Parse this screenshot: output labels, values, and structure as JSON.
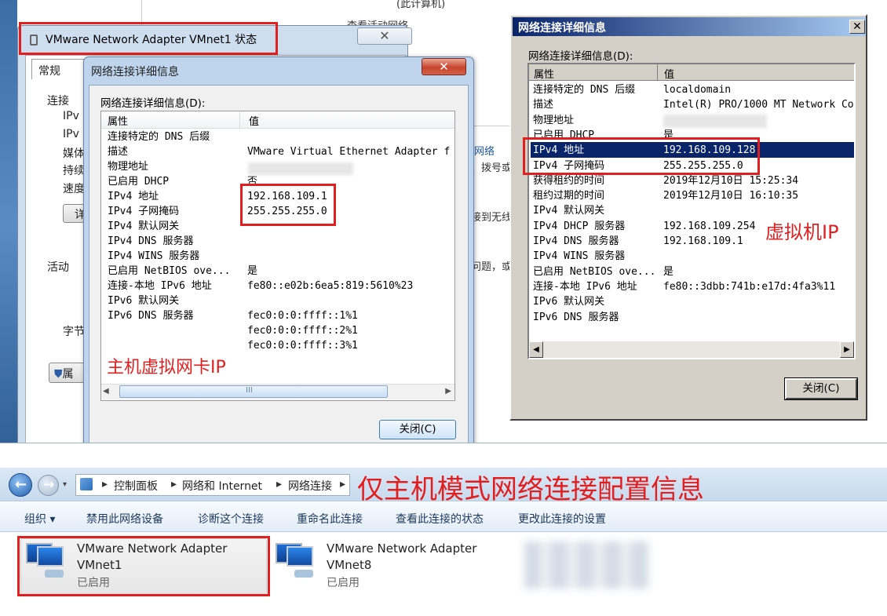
{
  "background": {
    "top_text": "(此计算机)",
    "active_networks": "查看活动网络",
    "link_partial": "网络",
    "dial_partial": "、拨号或",
    "connect_partial": "接到无线",
    "problem_partial": "问题，或"
  },
  "status_window": {
    "title": "VMware Network Adapter VMnet1 状态",
    "tab": "常规",
    "section_connection": "连接",
    "rows": [
      "IPv",
      "IPv",
      "媒体",
      "持续",
      "速度"
    ],
    "details_btn": "详",
    "section_activity": "活动",
    "bytes": "字节",
    "props_btn": "属"
  },
  "detail1": {
    "title": "网络连接详细信息",
    "label": "网络连接详细信息(D):",
    "col_prop": "属性",
    "col_val": "值",
    "rows": [
      {
        "k": "连接特定的 DNS 后缀",
        "v": ""
      },
      {
        "k": "描述",
        "v": "VMware Virtual Ethernet Adapter f"
      },
      {
        "k": "物理地址",
        "v": ""
      },
      {
        "k": "已启用 DHCP",
        "v": "否"
      },
      {
        "k": "IPv4 地址",
        "v": "192.168.109.1"
      },
      {
        "k": "IPv4 子网掩码",
        "v": "255.255.255.0"
      },
      {
        "k": "IPv4 默认网关",
        "v": ""
      },
      {
        "k": "IPv4 DNS 服务器",
        "v": ""
      },
      {
        "k": "IPv4 WINS 服务器",
        "v": ""
      },
      {
        "k": "已启用 NetBIOS ove...",
        "v": "是"
      },
      {
        "k": "连接-本地 IPv6 地址",
        "v": "fe80::e02b:6ea5:819:5610%23"
      },
      {
        "k": "IPv6 默认网关",
        "v": ""
      },
      {
        "k": "IPv6 DNS 服务器",
        "v": "fec0:0:0:ffff::1%1"
      },
      {
        "k": "",
        "v": "fec0:0:0:ffff::2%1"
      },
      {
        "k": "",
        "v": "fec0:0:0:ffff::3%1"
      }
    ],
    "scroll_grip": "III",
    "close_btn": "关闭(C)"
  },
  "detail2": {
    "title": "网络连接详细信息",
    "label": "网络连接详细信息(D):",
    "col_prop": "属性",
    "col_val": "值",
    "rows": [
      {
        "k": "连接特定的 DNS 后缀",
        "v": "localdomain"
      },
      {
        "k": "描述",
        "v": "Intel(R) PRO/1000 MT Network Conn"
      },
      {
        "k": "物理地址",
        "v": ""
      },
      {
        "k": "已启用 DHCP",
        "v": "是"
      },
      {
        "k": "IPv4 地址",
        "v": "192.168.109.128"
      },
      {
        "k": "IPv4 子网掩码",
        "v": "255.255.255.0"
      },
      {
        "k": "获得租约的时间",
        "v": "2019年12月10日 15:25:34"
      },
      {
        "k": "租约过期的时间",
        "v": "2019年12月10日 16:10:35"
      },
      {
        "k": "IPv4 默认网关",
        "v": ""
      },
      {
        "k": "IPv4 DHCP 服务器",
        "v": "192.168.109.254"
      },
      {
        "k": "IPv4 DNS 服务器",
        "v": "192.168.109.1"
      },
      {
        "k": "IPv4 WINS 服务器",
        "v": ""
      },
      {
        "k": "已启用 NetBIOS ove...",
        "v": "是"
      },
      {
        "k": "连接-本地 IPv6 地址",
        "v": "fe80::3dbb:741b:e17d:4fa3%11"
      },
      {
        "k": "IPv6 默认网关",
        "v": ""
      },
      {
        "k": "IPv6 DNS 服务器",
        "v": ""
      }
    ],
    "close_btn": "关闭(C)",
    "selected_index": 4
  },
  "annotations": {
    "host_ip": "主机虚拟网卡IP",
    "vm_ip": "虚拟机IP",
    "headline": "仅主机模式网络连接配置信息",
    "color": "#e31e1e"
  },
  "explorer": {
    "breadcrumb": [
      "控制面板",
      "网络和 Internet",
      "网络连接"
    ],
    "toolbar": [
      "组织 ▾",
      "禁用此网络设备",
      "诊断这个连接",
      "重命名此连接",
      "查看此连接的状态",
      "更改此连接的设置"
    ],
    "adapters": [
      {
        "name1": "VMware Network Adapter",
        "name2": "VMnet1",
        "status": "已启用"
      },
      {
        "name1": "VMware Network Adapter",
        "name2": "VMnet8",
        "status": "已启用"
      }
    ]
  }
}
